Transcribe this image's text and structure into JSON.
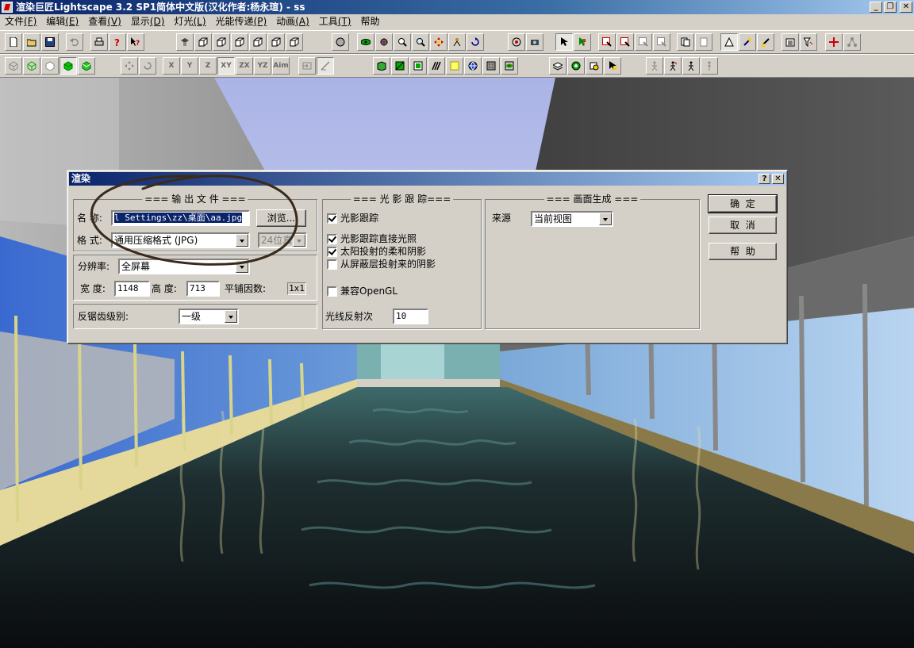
{
  "window": {
    "title": "渲染巨匠Lightscape 3.2 SP1简体中文版(汉化作者:杨永瑄) - ss",
    "min_label": "_",
    "restore_label": "❐",
    "close_label": "✕"
  },
  "menu": [
    {
      "label": "文件",
      "hotkey": "(F)"
    },
    {
      "label": "编辑",
      "hotkey": "(E)"
    },
    {
      "label": "查看",
      "hotkey": "(V)"
    },
    {
      "label": "显示",
      "hotkey": "(D)"
    },
    {
      "label": "灯光",
      "hotkey": "(L)"
    },
    {
      "label": "光能传递",
      "hotkey": "(P)"
    },
    {
      "label": "动画",
      "hotkey": "(A)"
    },
    {
      "label": "工具",
      "hotkey": "(T)"
    },
    {
      "label": "帮助",
      "hotkey": ""
    }
  ],
  "toolbar2": {
    "x": "X",
    "y": "Y",
    "z": "Z",
    "xy": "XY",
    "zx": "ZX",
    "yz": "YZ",
    "aim": "Aim"
  },
  "dialog": {
    "title": "渲染",
    "help_label": "?",
    "close_label": "✕",
    "output": {
      "caption": "=== 输 出 文 件 ===",
      "name_label": "名 称:",
      "name_value": "l Settings\\zz\\桌面\\aa.jpg",
      "browse_label": "浏览...",
      "format_label": "格 式:",
      "format_value": "通用压缩格式 (JPG)",
      "bitdepth_value": "24位真"
    },
    "resolution": {
      "label": "分辨率:",
      "value": "全屏幕",
      "width_label": "宽 度:",
      "width_value": "1148",
      "height_label": "高 度:",
      "height_value": "713",
      "tile_label": "平铺因数:",
      "tile_value": "1x1"
    },
    "antialias": {
      "label": "反锯齿级别:",
      "value": "一级"
    },
    "raytrace": {
      "caption": "=== 光 影 跟 踪===",
      "options": [
        {
          "label": "光影跟踪",
          "checked": true
        },
        {
          "label": "光影跟踪直接光照",
          "checked": true
        },
        {
          "label": "太阳投射的柔和阴影",
          "checked": true
        },
        {
          "label": "从屏蔽层投射来的阴影",
          "checked": false
        },
        {
          "label": "兼容OpenGL",
          "checked": false
        }
      ],
      "reflect_label": "光线反射次",
      "reflect_value": "10"
    },
    "frame": {
      "caption": "=== 画面生成 ===",
      "source_label": "来源",
      "source_value": "当前视图"
    },
    "ok_label": "确  定",
    "cancel_label": "取  消",
    "help_btn_label": "帮  助"
  },
  "colors": {
    "titlebar_start": "#0a246a",
    "titlebar_end": "#a6caf0",
    "face": "#d4d0c8",
    "annotation": "#3a2a1c"
  }
}
